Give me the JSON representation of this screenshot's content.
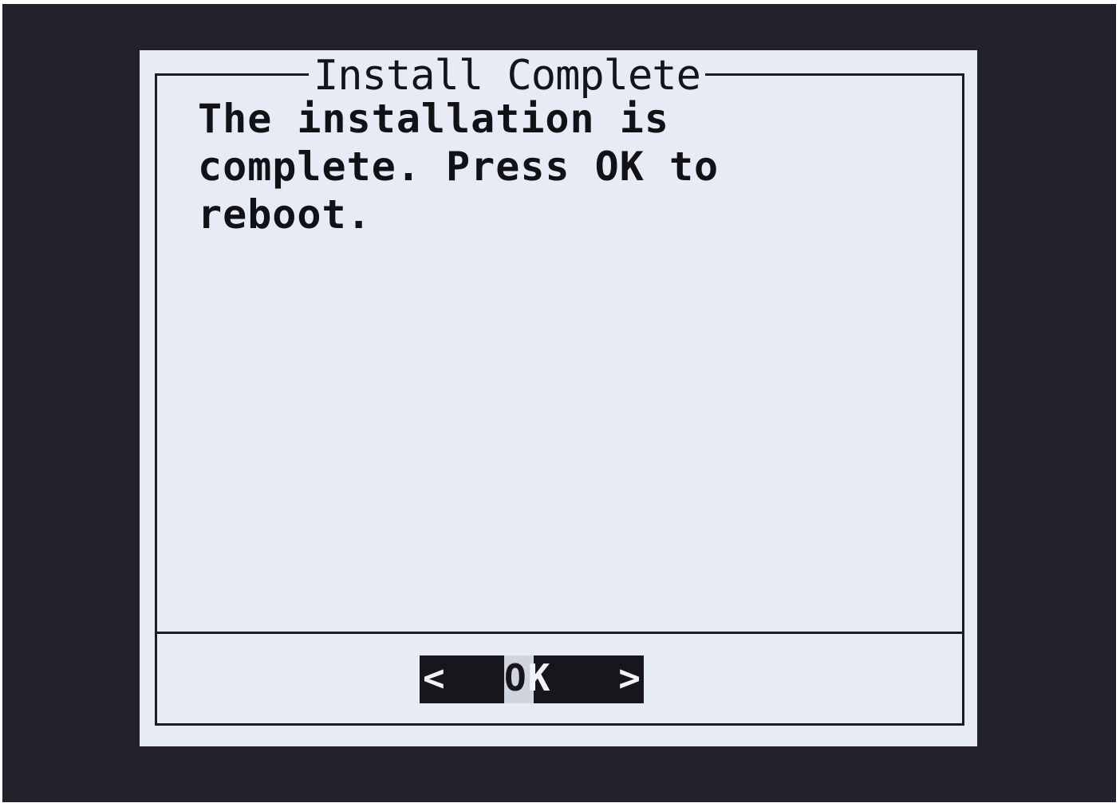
{
  "screen": {
    "background_color": "#23222c"
  },
  "dialog": {
    "title": "Install Complete",
    "message_lines": [
      "The installation is",
      "complete. Press OK to",
      "reboot."
    ],
    "background_color": "#e6ebf5"
  },
  "ok_button": {
    "left_bracket": "<",
    "label_first_char": "O",
    "label_rest": "K",
    "right_bracket": ">",
    "focused": true
  }
}
